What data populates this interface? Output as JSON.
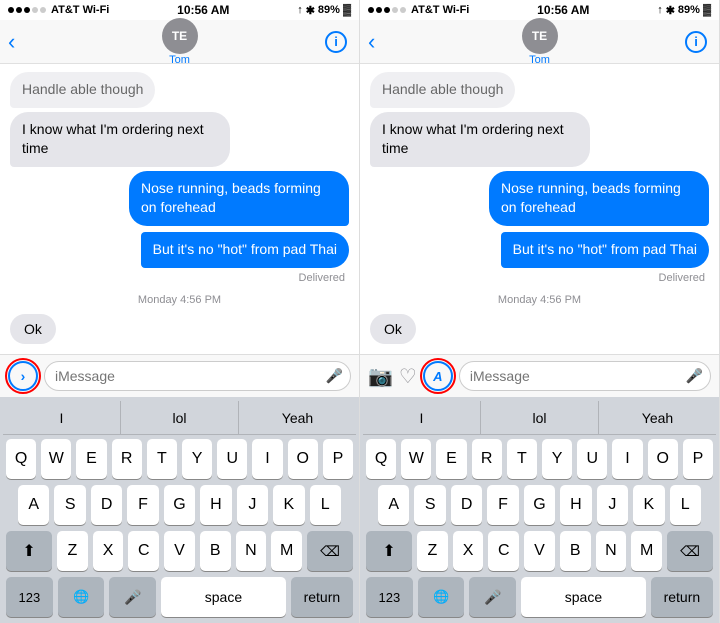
{
  "panels": [
    {
      "id": "left",
      "status": {
        "signal": "●●●○○",
        "carrier": "AT&T Wi-Fi",
        "time": "10:56 AM",
        "battery": "89%"
      },
      "nav": {
        "avatar_initials": "TE",
        "contact_name": "Tom"
      },
      "messages": [
        {
          "type": "incoming-truncated",
          "text": "Handle able though"
        },
        {
          "type": "incoming",
          "text": "I know what I'm ordering next time"
        },
        {
          "type": "outgoing",
          "text": "Nose running, beads forming on forehead"
        },
        {
          "type": "outgoing-second",
          "text": "But it's no \"hot\" from pad Thai"
        },
        {
          "type": "delivered",
          "text": "Delivered"
        },
        {
          "type": "time",
          "text": "Monday 4:56 PM"
        },
        {
          "type": "incoming",
          "text": "Ok"
        }
      ],
      "input": {
        "placeholder": "iMessage",
        "expand_icon": "›",
        "highlight": "expand",
        "show_expand": true
      },
      "keyboard": {
        "predictive": [
          "I",
          "lol",
          "Yeah"
        ],
        "rows": [
          [
            "Q",
            "W",
            "E",
            "R",
            "T",
            "Y",
            "U",
            "I",
            "O",
            "P"
          ],
          [
            "A",
            "S",
            "D",
            "F",
            "G",
            "H",
            "J",
            "K",
            "L"
          ],
          [
            "Z",
            "X",
            "C",
            "V",
            "B",
            "N",
            "M"
          ],
          [
            "123",
            "🌐",
            "🎤",
            "space",
            "return"
          ]
        ]
      }
    },
    {
      "id": "right",
      "status": {
        "signal": "●●●○○",
        "carrier": "AT&T Wi-Fi",
        "time": "10:56 AM",
        "battery": "89%"
      },
      "nav": {
        "avatar_initials": "TE",
        "contact_name": "Tom"
      },
      "messages": [
        {
          "type": "incoming-truncated",
          "text": "Handle able though"
        },
        {
          "type": "incoming",
          "text": "I know what I'm ordering next time"
        },
        {
          "type": "outgoing",
          "text": "Nose running, beads forming on forehead"
        },
        {
          "type": "outgoing-second",
          "text": "But it's no \"hot\" from pad Thai"
        },
        {
          "type": "delivered",
          "text": "Delivered"
        },
        {
          "type": "time",
          "text": "Monday 4:56 PM"
        },
        {
          "type": "incoming",
          "text": "Ok"
        }
      ],
      "input": {
        "placeholder": "iMessage",
        "expand_icon": "A",
        "highlight": "app",
        "show_expand": true,
        "show_camera": true,
        "show_heart": true
      },
      "keyboard": {
        "predictive": [
          "I",
          "lol",
          "Yeah"
        ],
        "rows": [
          [
            "Q",
            "W",
            "E",
            "R",
            "T",
            "Y",
            "U",
            "I",
            "O",
            "P"
          ],
          [
            "A",
            "S",
            "D",
            "F",
            "G",
            "H",
            "J",
            "K",
            "L"
          ],
          [
            "Z",
            "X",
            "C",
            "V",
            "B",
            "N",
            "M"
          ],
          [
            "123",
            "🌐",
            "🎤",
            "space",
            "return"
          ]
        ]
      }
    }
  ]
}
